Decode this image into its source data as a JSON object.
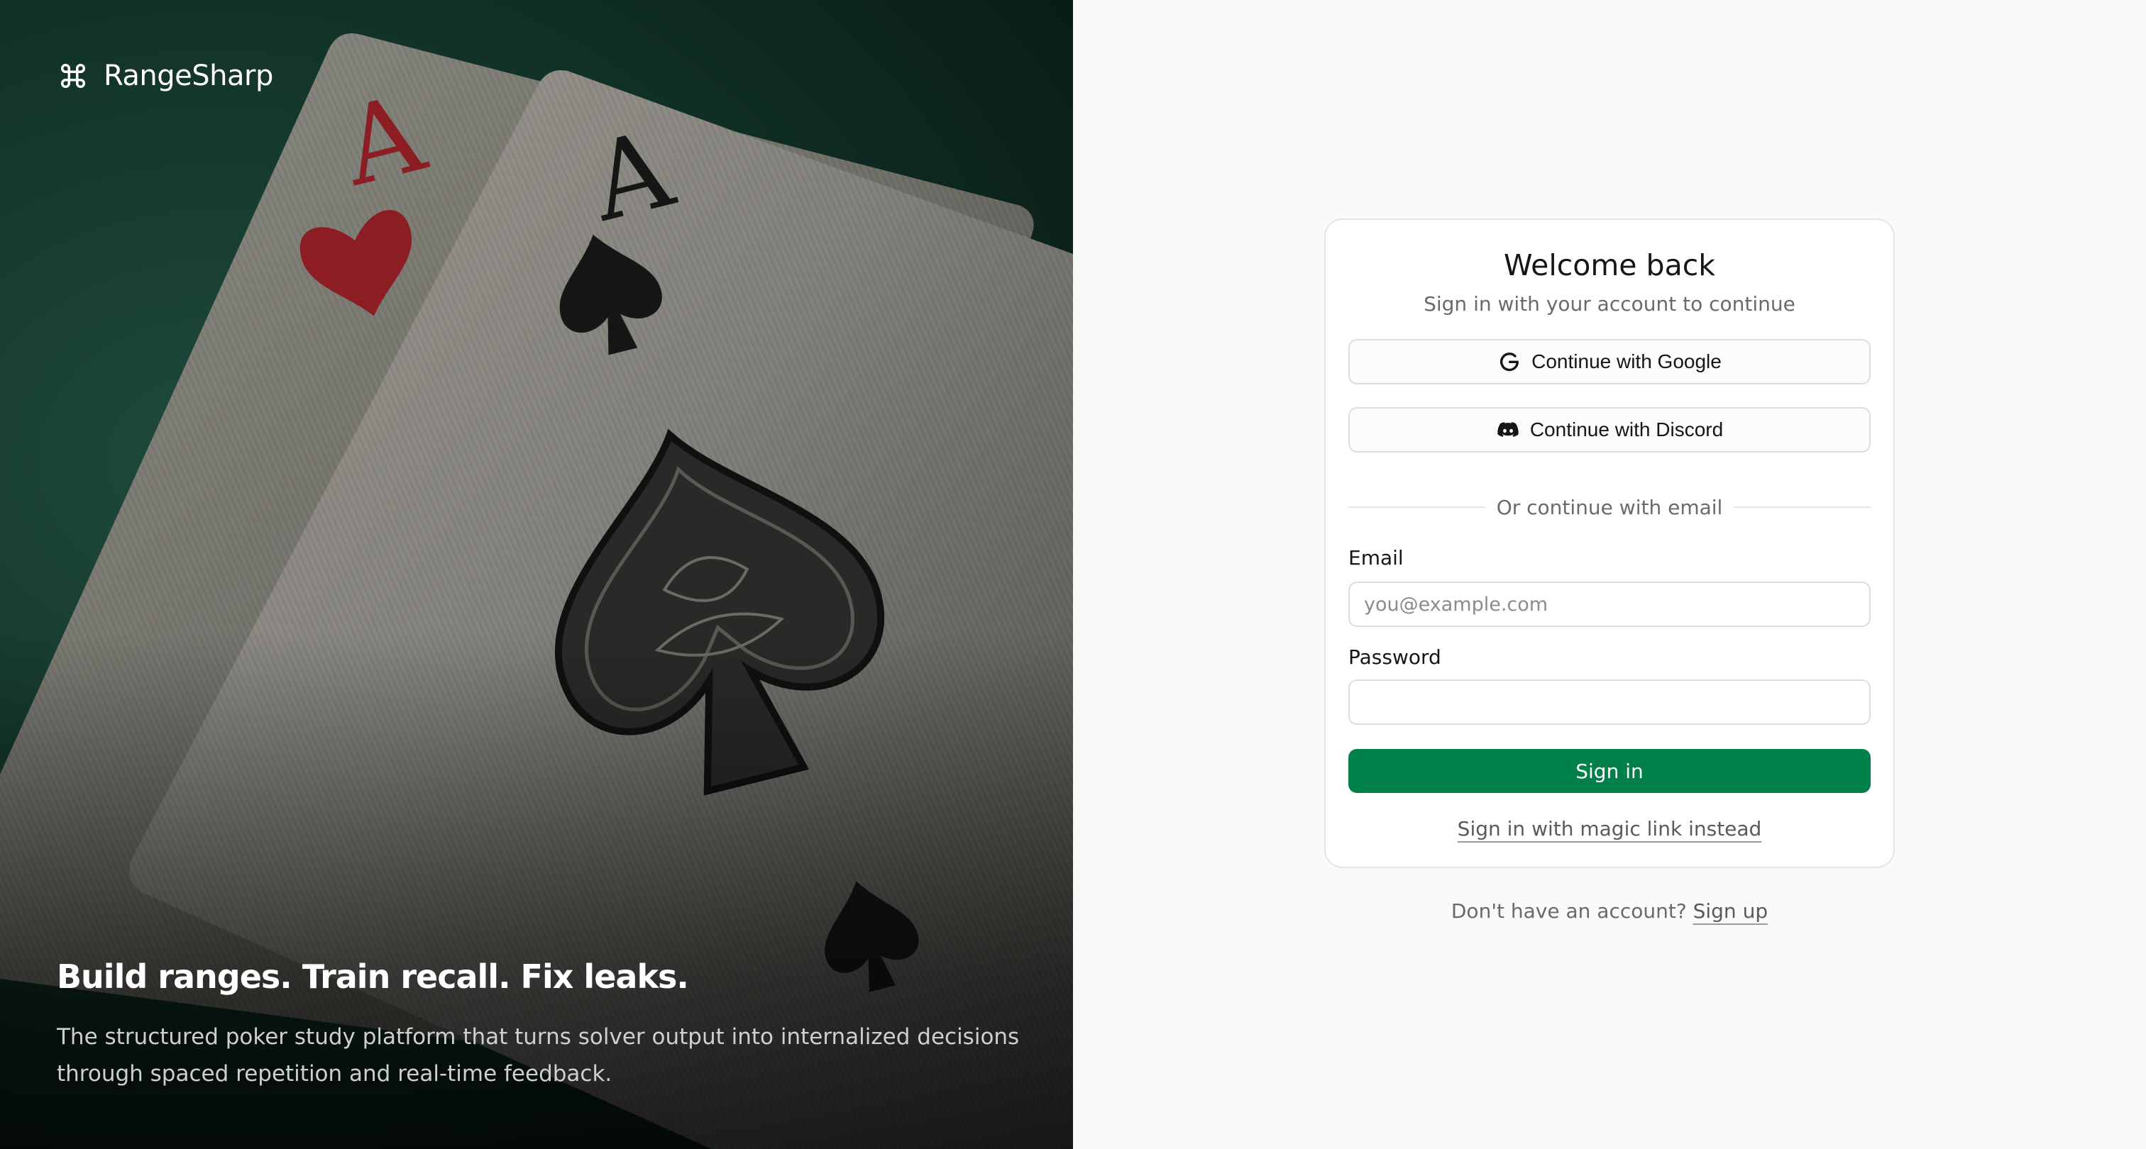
{
  "brand": {
    "name": "RangeSharp",
    "icon": "command-icon"
  },
  "hero": {
    "tagline": "Build ranges. Train recall. Fix leaks.",
    "description": "The structured poker study platform that turns solver output into internalized decisions through spaced repetition and real-time feedback.",
    "card_left_rank": "A",
    "card_right_rank": "A"
  },
  "auth": {
    "title": "Welcome back",
    "subtitle": "Sign in with your account to continue",
    "google_label": "Continue with Google",
    "discord_label": "Continue with Discord",
    "divider_text": "Or continue with email",
    "email_label": "Email",
    "email_placeholder": "you@example.com",
    "email_value": "",
    "password_label": "Password",
    "password_value": "",
    "submit_label": "Sign in",
    "magic_link_label": "Sign in with magic link instead"
  },
  "signup": {
    "prompt": "Don't have an account?",
    "link_label": "Sign up"
  },
  "colors": {
    "primary": "#00804a",
    "hero_felt": "#123328",
    "heart_red": "#8c1d22",
    "text": "#161616",
    "muted": "#6a6a6a"
  }
}
